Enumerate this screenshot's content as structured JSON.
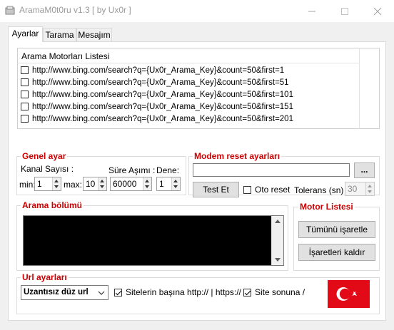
{
  "window": {
    "title": "AramaM0t0ru v1.3 [ by Ux0r ]",
    "minimize_icon": "minimize-icon",
    "maximize_icon": "maximize-icon",
    "close_icon": "close-icon"
  },
  "tabs": [
    {
      "label": "Ayarlar",
      "active": true
    },
    {
      "label": "Tarama",
      "active": false
    },
    {
      "label": "Mesajım",
      "active": false
    }
  ],
  "engine_list": {
    "header": "Arama Motorları Listesi",
    "items": [
      "http://www.bing.com/search?q={Ux0r_Arama_Key}&count=50&first=1",
      "http://www.bing.com/search?q={Ux0r_Arama_Key}&count=50&first=51",
      "http://www.bing.com/search?q={Ux0r_Arama_Key}&count=50&first=101",
      "http://www.bing.com/search?q={Ux0r_Arama_Key}&count=50&first=151",
      "http://www.bing.com/search?q={Ux0r_Arama_Key}&count=50&first=201"
    ]
  },
  "general": {
    "title": "Genel ayar",
    "channel_label": "Kanal Sayısı :",
    "min_label": "min:",
    "min_value": "1",
    "max_label": "max:",
    "max_value": "10",
    "timeout_label": "Süre Aşımı :",
    "timeout_value": "60000",
    "retry_label": "Dene:",
    "retry_value": "1"
  },
  "modem": {
    "title": "Modem reset ayarları",
    "path_value": "",
    "browse_label": "...",
    "test_label": "Test Et",
    "auto_reset_label": "Oto reset",
    "tolerance_label": "Tolerans (sn) :",
    "tolerance_value": "30"
  },
  "search_section": {
    "title": "Arama bölümü"
  },
  "engine_panel": {
    "title": "Motor Listesi",
    "select_all_label": "Tümünü işaretle",
    "clear_label": "İşaretleri kaldır"
  },
  "url_settings": {
    "title": "Url ayarları",
    "combo_value": "Uzantısız düz url",
    "prefix_label": "Sitelerin başına http:// | https://",
    "suffix_label": "Site sonuna /"
  },
  "colors": {
    "group_title": "#cc0000",
    "flag": "#e30a17"
  }
}
